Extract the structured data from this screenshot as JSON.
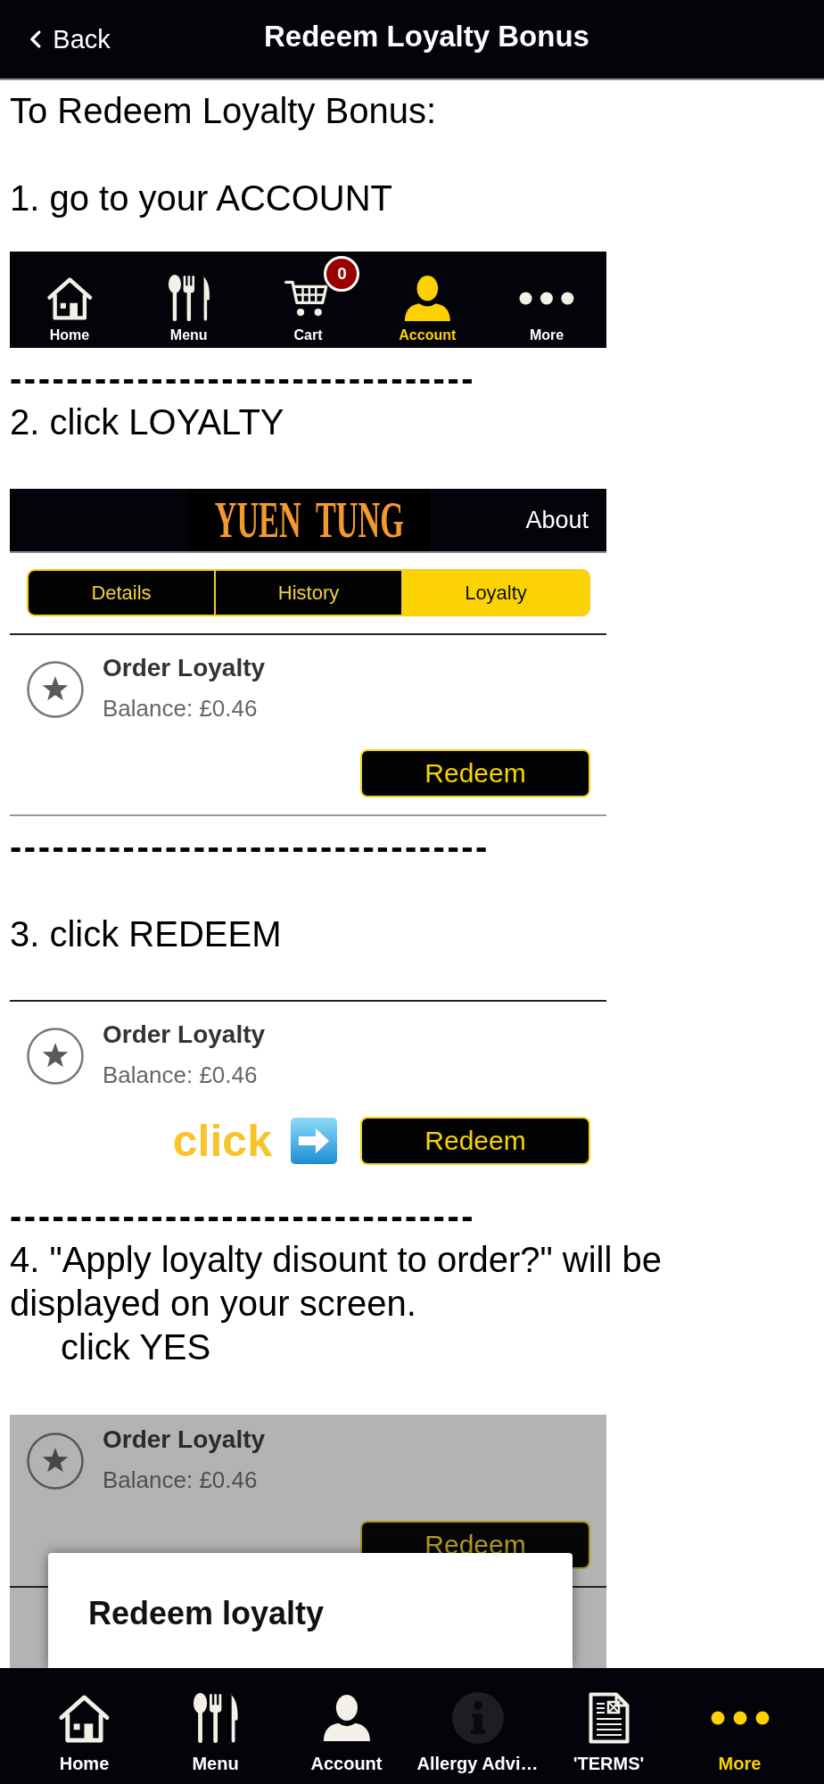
{
  "header": {
    "back": "Back",
    "title": "Redeem Loyalty Bonus"
  },
  "intro": "To Redeem Loyalty Bonus:",
  "steps": [
    {
      "text": "1. go to your ACCOUNT",
      "screenshot": {
        "kind": "tab_bar",
        "items": [
          {
            "label": "Home",
            "selected": false
          },
          {
            "label": "Menu",
            "selected": false
          },
          {
            "label": "Cart",
            "selected": false,
            "badge": "0"
          },
          {
            "label": "Account",
            "selected": true
          },
          {
            "label": "More",
            "selected": false
          }
        ]
      }
    },
    {
      "separator": "---------------------------------",
      "text": "2. click LOYALTY",
      "screenshot": {
        "kind": "account_page",
        "logo": "YUEN TUNG",
        "link": "About",
        "tabs": [
          {
            "label": "Details",
            "selected": false
          },
          {
            "label": "History",
            "selected": false
          },
          {
            "label": "Loyalty",
            "selected": true
          }
        ],
        "item": {
          "title": "Order Loyalty",
          "balance": "Balance: £0.46",
          "button": "Redeem"
        }
      }
    },
    {
      "separator": "----------------------------------",
      "text": "3. click REDEEM",
      "screenshot": {
        "kind": "loyalty_item",
        "hint": "click",
        "item": {
          "title": "Order Loyalty",
          "balance": "Balance: £0.46",
          "button": "Redeem"
        }
      }
    },
    {
      "separator": "---------------------------------",
      "text": "4. \"Apply loyalty disount to order?\" will be displayed on your screen.",
      "subtext": "click YES",
      "screenshot": {
        "kind": "confirm_dialog",
        "item": {
          "title": "Order Loyalty",
          "balance": "Balance: £0.46",
          "button": "Redeem"
        },
        "dialog_title": "Redeem loyalty"
      }
    }
  ],
  "tab_bar": {
    "items": [
      {
        "label": "Home",
        "selected": false
      },
      {
        "label": "Menu",
        "selected": false
      },
      {
        "label": "Account",
        "selected": false
      },
      {
        "label": "Allergy Advi…",
        "selected": false
      },
      {
        "label": "'TERMS'",
        "selected": false
      },
      {
        "label": "More",
        "selected": true
      }
    ]
  }
}
